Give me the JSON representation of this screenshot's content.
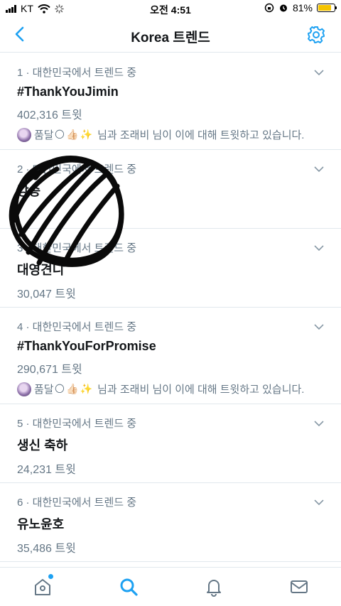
{
  "status_bar": {
    "carrier": "KT",
    "time": "오전 4:51",
    "battery": "81%",
    "battery_level": 0.81
  },
  "header": {
    "title": "Korea 트렌드"
  },
  "trends": [
    {
      "meta": "1 · 대한민국에서 트렌드 중",
      "name": "#ThankYouJimin",
      "count": "402,316 트윗",
      "tweeting": {
        "user": "품달",
        "text": "님과 조래비 님이 이에 대해 트윗하고 있습니다."
      }
    },
    {
      "meta": "2 · 대한민국에서 트렌드 중",
      "name": "강승",
      "count": ""
    },
    {
      "meta": "3 · 대한민국에서 트렌드 중",
      "name": "대영견니",
      "count": "30,047 트윗"
    },
    {
      "meta": "4 · 대한민국에서 트렌드 중",
      "name": "#ThankYouForPromise",
      "count": "290,671 트윗",
      "tweeting": {
        "user": "품달",
        "text": "님과 조래비 님이 이에 대해 트윗하고 있습니다."
      }
    },
    {
      "meta": "5 · 대한민국에서 트렌드 중",
      "name": "생신 축하",
      "count": "24,231 트윗"
    },
    {
      "meta": "6 · 대한민국에서 트렌드 중",
      "name": "유노윤호",
      "count": "35,486 트윗"
    }
  ],
  "tabs": [
    {
      "id": "home",
      "icon": "home-icon",
      "notification_dot": true
    },
    {
      "id": "search",
      "icon": "search-icon",
      "active": true
    },
    {
      "id": "notifications",
      "icon": "bell-icon"
    },
    {
      "id": "messages",
      "icon": "mail-icon"
    }
  ],
  "colors": {
    "accent": "#1da1f2",
    "secondary_text": "#657786",
    "divider": "#e1e8ed",
    "battery": "#f5c400"
  }
}
